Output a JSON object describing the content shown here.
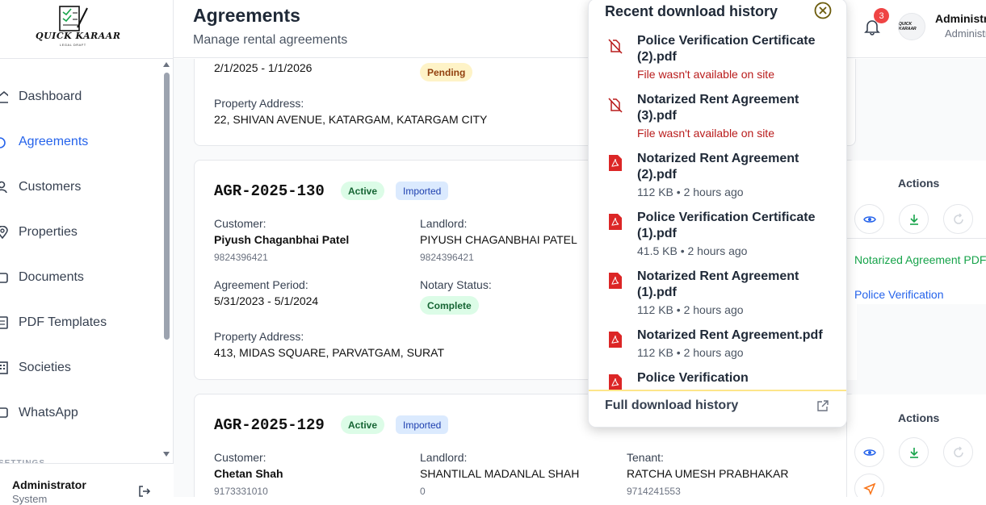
{
  "logo": {
    "text": "QUICK KARAAR",
    "sub": "LEGAL DRAFT"
  },
  "sidebar": {
    "items": [
      {
        "label": "Dashboard",
        "icon": "home-icon"
      },
      {
        "label": "Agreements",
        "icon": "file-icon",
        "active": true
      },
      {
        "label": "Customers",
        "icon": "users-icon"
      },
      {
        "label": "Properties",
        "icon": "map-pin-icon"
      },
      {
        "label": "Documents",
        "icon": "folder-icon"
      },
      {
        "label": "PDF Templates",
        "icon": "template-icon"
      },
      {
        "label": "Societies",
        "icon": "building-icon"
      },
      {
        "label": "WhatsApp",
        "icon": "chat-icon"
      }
    ],
    "settings_label": "SETTINGS",
    "user": {
      "name": "Administrator",
      "role": "System"
    }
  },
  "header": {
    "title": "Agreements",
    "subtitle": "Manage rental agreements",
    "notification_count": "3",
    "user_name": "Administrator",
    "user_role": "Administrator"
  },
  "cards": [
    {
      "period": "2/1/2025 - 1/1/2026",
      "notary_status": "Pending",
      "address_label": "Property Address:",
      "address": "22, SHIVAN AVENUE, KATARGAM, KATARGAM CITY"
    },
    {
      "id": "AGR-2025-130",
      "status": "Active",
      "source": "Imported",
      "customer_label": "Customer:",
      "customer": "Piyush Chaganbhai Patel",
      "customer_phone": "9824396421",
      "landlord_label": "Landlord:",
      "landlord": "PIYUSH CHAGANBHAI PATEL",
      "landlord_phone": "9824396421",
      "period_label": "Agreement Period:",
      "period": "5/31/2023 - 5/1/2024",
      "notary_label": "Notary Status:",
      "notary_status": "Complete",
      "address_label": "Property Address:",
      "address": "413, MIDAS SQUARE, PARVATGAM, SURAT"
    },
    {
      "id": "AGR-2025-129",
      "status": "Active",
      "source": "Imported",
      "customer_label": "Customer:",
      "customer": "Chetan Shah",
      "customer_phone": "9173331010",
      "landlord_label": "Landlord:",
      "landlord": "SHANTILAL MADANLAL SHAH",
      "landlord_phone": "0",
      "tenant_label": "Tenant:",
      "tenant": "RATCHA UMESH PRABHAKAR",
      "tenant_phone": "9714241553"
    }
  ],
  "actions": {
    "title": "Actions",
    "doc_links": [
      "Notarized Agreement PDF",
      "Police Verification"
    ],
    "colors": {
      "green": "#16a34a",
      "blue": "#2563eb"
    }
  },
  "download_popup": {
    "title": "Recent download history",
    "items": [
      {
        "name": "Police Verification Certificate (2).pdf",
        "meta": "File wasn't available on site",
        "error": true
      },
      {
        "name": "Notarized Rent Agreement (3).pdf",
        "meta": "File wasn't available on site",
        "error": true
      },
      {
        "name": "Notarized Rent Agreement (2).pdf",
        "meta": "112 KB • 2 hours ago",
        "error": false
      },
      {
        "name": "Police Verification Certificate (1).pdf",
        "meta": "41.5 KB • 2 hours ago",
        "error": false
      },
      {
        "name": "Notarized Rent Agreement (1).pdf",
        "meta": "112 KB • 2 hours ago",
        "error": false
      },
      {
        "name": "Notarized Rent Agreement.pdf",
        "meta": "112 KB • 2 hours ago",
        "error": false
      },
      {
        "name": "Police Verification",
        "meta": "",
        "error": false
      }
    ],
    "footer": "Full download history"
  }
}
